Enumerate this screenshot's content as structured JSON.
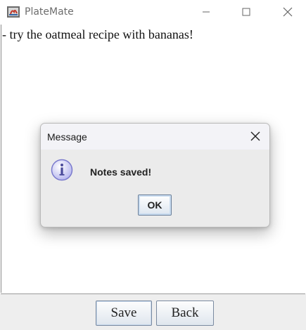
{
  "window": {
    "title": "PlateMate"
  },
  "editor": {
    "content": "- try the oatmeal recipe with bananas!"
  },
  "buttons": {
    "save_label": "Save",
    "back_label": "Back"
  },
  "dialog": {
    "title": "Message",
    "message": "Notes saved!",
    "ok_label": "OK",
    "icon": "info-icon"
  },
  "colors": {
    "dialog_background": "#ebebeb",
    "info_icon_fill": "#c9c9f4",
    "button_border": "#7a8aa0"
  }
}
